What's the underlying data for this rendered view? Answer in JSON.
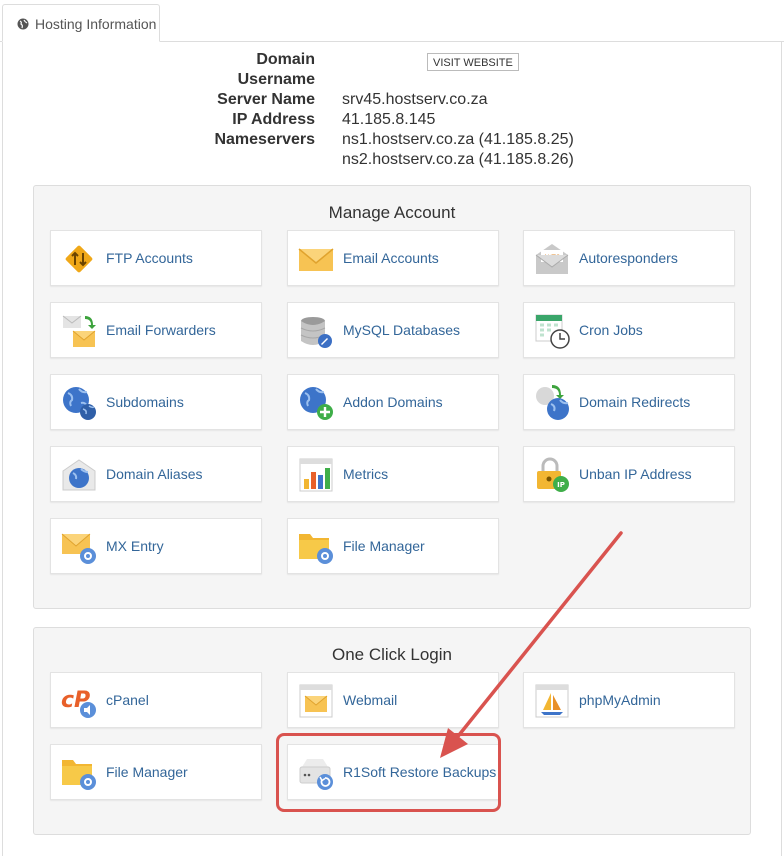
{
  "tab": {
    "label": "Hosting Information"
  },
  "info": {
    "domain_label": "Domain",
    "username_label": "Username",
    "server_label": "Server Name",
    "server_value": "srv45.hostserv.co.za",
    "ip_label": "IP Address",
    "ip_value": "41.185.8.145",
    "ns_label": "Nameservers",
    "ns1": "ns1.hostserv.co.za (41.185.8.25)",
    "ns2": "ns2.hostserv.co.za (41.185.8.26)",
    "visit_button": "VISIT WEBSITE"
  },
  "manage": {
    "title": "Manage Account",
    "items": [
      {
        "label": "FTP Accounts",
        "icon": "ftp-icon"
      },
      {
        "label": "Email Accounts",
        "icon": "envelope-icon"
      },
      {
        "label": "Autoresponders",
        "icon": "autoresponder-icon"
      },
      {
        "label": "Email Forwarders",
        "icon": "email-forwarder-icon"
      },
      {
        "label": "MySQL Databases",
        "icon": "database-icon"
      },
      {
        "label": "Cron Jobs",
        "icon": "calendar-clock-icon"
      },
      {
        "label": "Subdomains",
        "icon": "globe-icon"
      },
      {
        "label": "Addon Domains",
        "icon": "globe-plus-icon"
      },
      {
        "label": "Domain Redirects",
        "icon": "globe-redirect-icon"
      },
      {
        "label": "Domain Aliases",
        "icon": "globe-alias-icon"
      },
      {
        "label": "Metrics",
        "icon": "bar-chart-icon"
      },
      {
        "label": "Unban IP Address",
        "icon": "padlock-ip-icon"
      },
      {
        "label": "MX Entry",
        "icon": "envelope-gear-icon"
      },
      {
        "label": "File Manager",
        "icon": "folder-gear-icon"
      }
    ]
  },
  "login": {
    "title": "One Click Login",
    "items": [
      {
        "label": "cPanel",
        "icon": "cpanel-icon"
      },
      {
        "label": "Webmail",
        "icon": "webmail-icon"
      },
      {
        "label": "phpMyAdmin",
        "icon": "phpmyadmin-icon"
      },
      {
        "label": "File Manager",
        "icon": "folder-gear-icon"
      },
      {
        "label": "R1Soft Restore Backups",
        "icon": "drive-restore-icon"
      }
    ]
  },
  "colors": {
    "link": "#336699",
    "annotation": "#d9534f",
    "panel": "#f5f5f5"
  }
}
